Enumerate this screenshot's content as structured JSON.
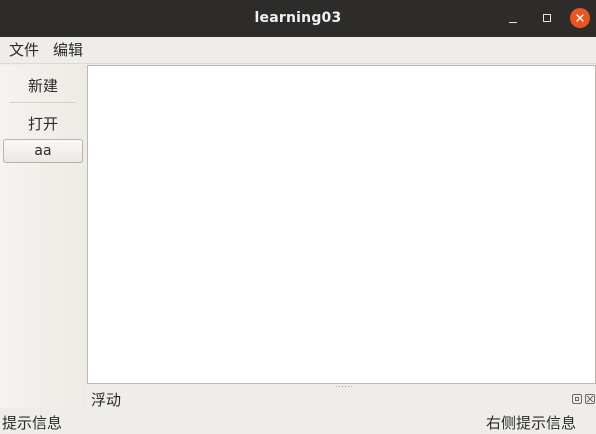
{
  "window": {
    "title": "learning03",
    "controls": [
      "minimize-icon",
      "maximize-icon",
      "close-icon"
    ],
    "close_color": "#e95420"
  },
  "menubar": {
    "items": [
      {
        "label": "文件"
      },
      {
        "label": "编辑"
      }
    ]
  },
  "toolbar": {
    "new_label": "新建",
    "open_label": "打开",
    "aa_label": "aa"
  },
  "dock": {
    "title": "浮动",
    "buttons": [
      "float-icon",
      "close-icon"
    ]
  },
  "statusbar": {
    "left_text": "提示信息",
    "right_text": "右侧提示信息"
  }
}
